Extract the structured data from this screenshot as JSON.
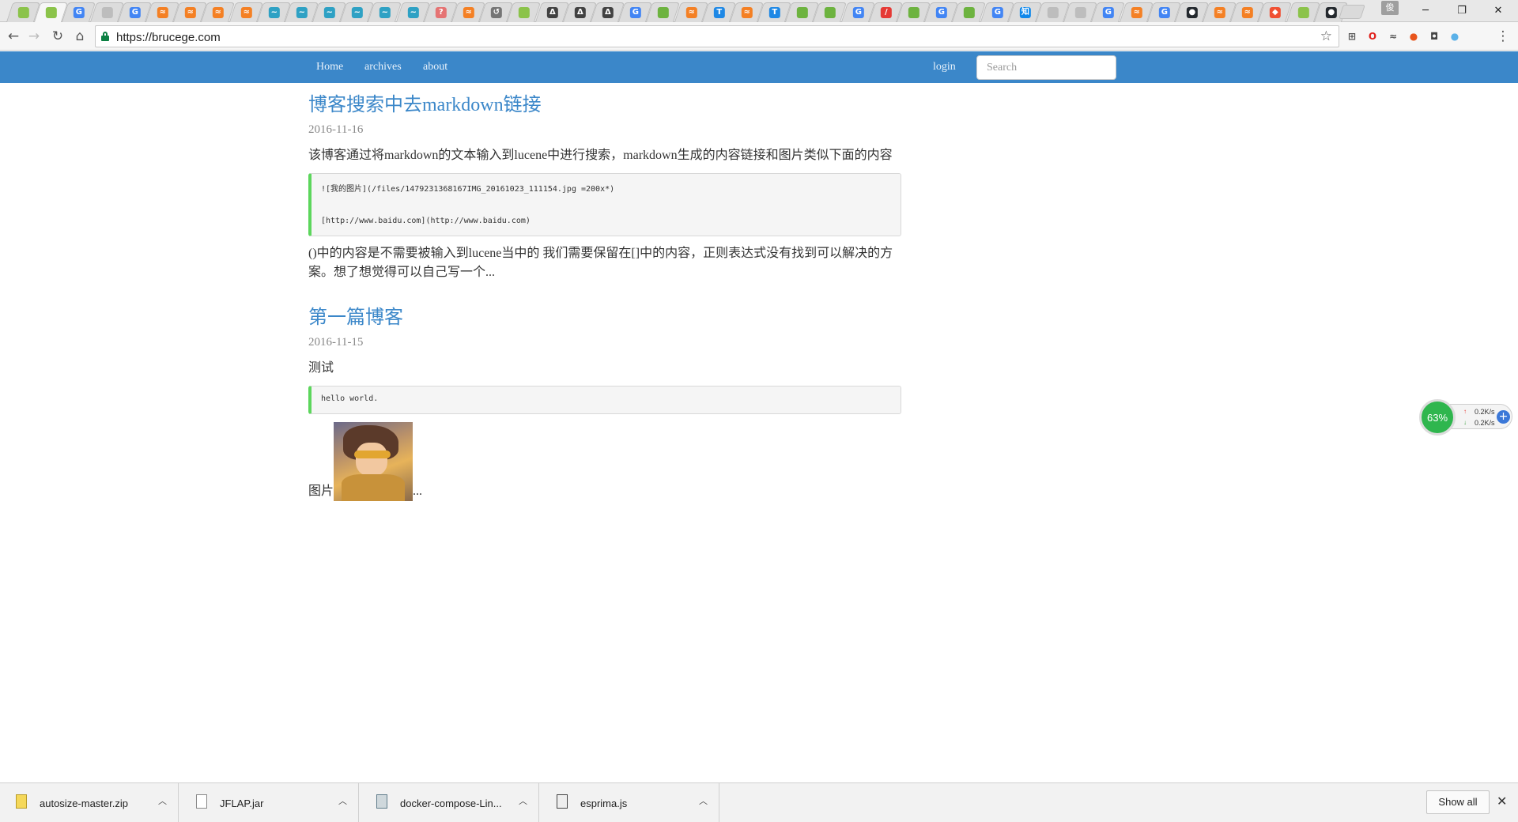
{
  "browser": {
    "url": "https://brucege.com",
    "profile_label": "俊",
    "tab_favicons": [
      {
        "label": "",
        "color": "#8bc34a"
      },
      {
        "label": "",
        "color": "#8bc34a"
      },
      {
        "label": "G",
        "color": "#4285f4"
      },
      {
        "label": "",
        "color": "#bdbdbd"
      },
      {
        "label": "G",
        "color": "#4285f4"
      },
      {
        "label": "≈",
        "color": "#f48024"
      },
      {
        "label": "≈",
        "color": "#f48024"
      },
      {
        "label": "≈",
        "color": "#f48024"
      },
      {
        "label": "≈",
        "color": "#f48024"
      },
      {
        "label": "~",
        "color": "#2ea1c4"
      },
      {
        "label": "~",
        "color": "#2ea1c4"
      },
      {
        "label": "~",
        "color": "#2ea1c4"
      },
      {
        "label": "~",
        "color": "#2ea1c4"
      },
      {
        "label": "~",
        "color": "#2ea1c4"
      },
      {
        "label": "~",
        "color": "#2ea1c4"
      },
      {
        "label": "?",
        "color": "#e57373"
      },
      {
        "label": "≈",
        "color": "#f48024"
      },
      {
        "label": "↺",
        "color": "#757575"
      },
      {
        "label": "",
        "color": "#8bc34a"
      },
      {
        "label": "Δ",
        "color": "#424242"
      },
      {
        "label": "Δ",
        "color": "#424242"
      },
      {
        "label": "Δ",
        "color": "#424242"
      },
      {
        "label": "G",
        "color": "#4285f4"
      },
      {
        "label": "",
        "color": "#6db33f"
      },
      {
        "label": "≈",
        "color": "#f48024"
      },
      {
        "label": "T",
        "color": "#1e88e5"
      },
      {
        "label": "≈",
        "color": "#f48024"
      },
      {
        "label": "T",
        "color": "#1e88e5"
      },
      {
        "label": "",
        "color": "#6db33f"
      },
      {
        "label": "",
        "color": "#6db33f"
      },
      {
        "label": "G",
        "color": "#4285f4"
      },
      {
        "label": "/",
        "color": "#e53935"
      },
      {
        "label": "",
        "color": "#6db33f"
      },
      {
        "label": "G",
        "color": "#4285f4"
      },
      {
        "label": "",
        "color": "#6db33f"
      },
      {
        "label": "G",
        "color": "#4285f4"
      },
      {
        "label": "知",
        "color": "#0f88eb"
      },
      {
        "label": "",
        "color": "#bdbdbd"
      },
      {
        "label": "",
        "color": "#bdbdbd"
      },
      {
        "label": "G",
        "color": "#4285f4"
      },
      {
        "label": "≈",
        "color": "#f48024"
      },
      {
        "label": "G",
        "color": "#4285f4"
      },
      {
        "label": "●",
        "color": "#24292e"
      },
      {
        "label": "≈",
        "color": "#f48024"
      },
      {
        "label": "≈",
        "color": "#f48024"
      },
      {
        "label": "◆",
        "color": "#f05033"
      },
      {
        "label": "",
        "color": "#8bc34a"
      },
      {
        "label": "●",
        "color": "#24292e"
      }
    ],
    "extensions": [
      {
        "name": "qr-code-icon",
        "label": "⊞",
        "color": "#555555"
      },
      {
        "name": "opera-icon",
        "label": "O",
        "color": "#e0201b"
      },
      {
        "name": "chart-icon",
        "label": "≈",
        "color": "#555555"
      },
      {
        "name": "fruit-icon",
        "label": "●",
        "color": "#e8541c"
      },
      {
        "name": "pocket-icon",
        "label": "◘",
        "color": "#444444"
      },
      {
        "name": "color-icon",
        "label": "●",
        "color": "#5bb1e8"
      }
    ]
  },
  "nav": {
    "links": [
      "Home",
      "archives",
      "about"
    ],
    "login": "login",
    "search_placeholder": "Search"
  },
  "posts": [
    {
      "title": "博客搜索中去markdown链接",
      "date": "2016-11-16",
      "intro": "该博客通过将markdown的文本输入到lucene中进行搜索，markdown生成的内容链接和图片类似下面的内容",
      "code": [
        "![我的图片](/files/1479231368167IMG_20161023_111154.jpg =200x*)",
        "[http://www.baidu.com](http://www.baidu.com)"
      ],
      "outro": "()中的内容是不需要被输入到lucene当中的 我们需要保留在[]中的内容，正则表达式没有找到可以解决的方案。想了想觉得可以自己写一个..."
    },
    {
      "title": "第一篇博客",
      "date": "2016-11-15",
      "intro": "测试",
      "code": [
        "hello world."
      ],
      "image_caption": "图片",
      "ellipsis": "..."
    }
  ],
  "net_widget": {
    "percent": "63%",
    "up": "0.2K/s",
    "down": "0.2K/s"
  },
  "downloads": [
    {
      "name": "autosize-master.zip",
      "icon": "zip-icon"
    },
    {
      "name": "JFLAP.jar",
      "icon": "file-icon"
    },
    {
      "name": "docker-compose-Lin...",
      "icon": "binary-icon"
    },
    {
      "name": "esprima.js",
      "icon": "script-icon"
    }
  ],
  "shelf": {
    "show_all": "Show all"
  }
}
